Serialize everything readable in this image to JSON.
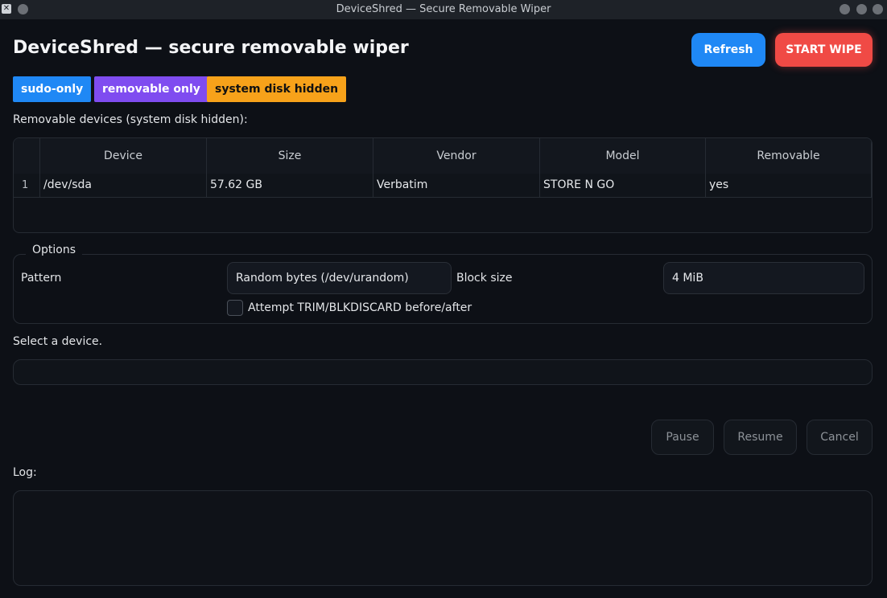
{
  "window": {
    "title": "DeviceShred — Secure Removable Wiper",
    "app_icon": "x-window-icon"
  },
  "header": {
    "title": "DeviceShred — secure removable wiper",
    "refresh_label": "Refresh",
    "start_wipe_label": "START WIPE"
  },
  "badges": [
    "sudo-only",
    "removable only",
    "system disk hidden"
  ],
  "colors": {
    "accent_blue": "#1f88f5",
    "danger_red": "#f04a45",
    "badge_purple": "#7f4cf0",
    "badge_orange": "#f7a21a",
    "background": "#0d1016"
  },
  "devices": {
    "label": "Removable devices (system disk hidden):",
    "columns": [
      "Device",
      "Size",
      "Vendor",
      "Model",
      "Removable"
    ],
    "rows": [
      {
        "index": "1",
        "cells": [
          "/dev/sda",
          "57.62 GB",
          "Verbatim",
          "STORE N GO",
          "yes"
        ]
      }
    ]
  },
  "options": {
    "title": "Options",
    "pattern_label": "Pattern",
    "pattern_value": "Random bytes (/dev/urandom)",
    "block_size_label": "Block size",
    "block_size_value": "4 MiB",
    "trim_label": "Attempt TRIM/BLKDISCARD before/after",
    "trim_checked": false
  },
  "status": {
    "text": "Select a device.",
    "progress": 0
  },
  "controls": {
    "pause_label": "Pause",
    "resume_label": "Resume",
    "cancel_label": "Cancel"
  },
  "log": {
    "label": "Log:",
    "content": ""
  }
}
